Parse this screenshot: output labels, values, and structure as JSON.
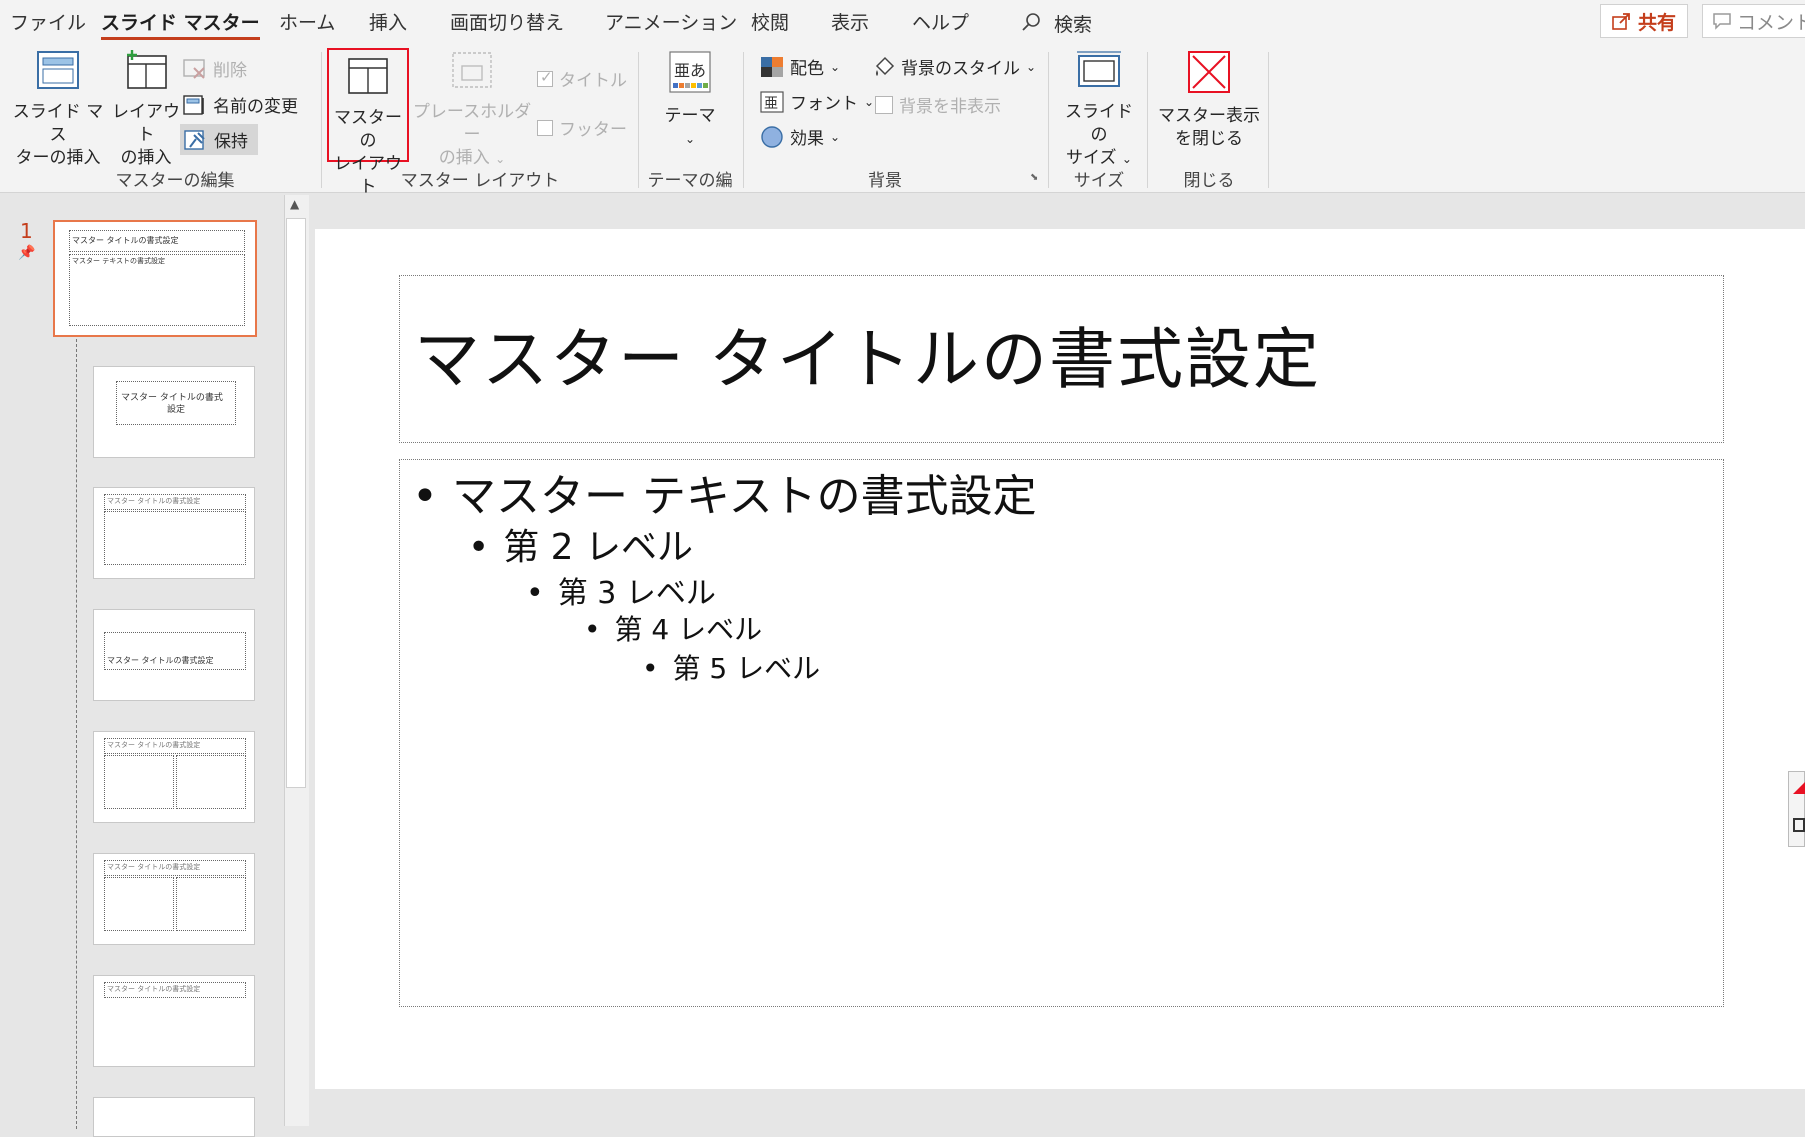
{
  "tabs": [
    "ファイル",
    "スライド マスター",
    "ホーム",
    "挿入",
    "画面切り替え",
    "アニメーション",
    "校閲",
    "表示",
    "ヘルプ"
  ],
  "search_label": "検索",
  "share_label": "共有",
  "comment_label": "コメント",
  "ribbon": {
    "insert_master_label1": "スライド マス",
    "insert_master_label2": "ターの挿入",
    "insert_layout_label1": "レイアウト",
    "insert_layout_label2": "の挿入",
    "delete_label": "削除",
    "rename_label": "名前の変更",
    "preserve_label": "保持",
    "group_master_edit": "マスターの編集",
    "master_layout_label1": "マスターの",
    "master_layout_label2": "レイアウト",
    "placeholder_label1": "プレースホルダー",
    "placeholder_label2": "の挿入",
    "title_check_label": "タイトル",
    "footer_check_label": "フッター",
    "group_master_layout": "マスター レイアウト",
    "theme_label": "テーマ",
    "group_theme_edit": "テーマの編集",
    "colors_label": "配色",
    "fonts_label": "フォント",
    "effects_label": "効果",
    "bg_styles_label": "背景のスタイル",
    "hide_bg_label": "背景を非表示",
    "group_background": "背景",
    "slide_size_label1": "スライドの",
    "slide_size_label2": "サイズ",
    "group_size": "サイズ",
    "close_master_label1": "マスター表示",
    "close_master_label2": "を閉じる",
    "group_close": "閉じる"
  },
  "thumbnails": {
    "slide_number": "1",
    "master_title": "マスター タイトルの書式設定",
    "master_text": "マスター テキストの書式設定",
    "layout_title_short": "マスター タイトルの書式",
    "layout_title_short2": "設定"
  },
  "slide": {
    "title": "マスター タイトルの書式設定",
    "levels": [
      "マスター テキストの書式設定",
      "第 2 レベル",
      "第 3 レベル",
      "第 4 レベル",
      "第 5 レベル"
    ]
  },
  "colors": {
    "accent": "#c43e1c",
    "highlight_box": "#e81123"
  }
}
